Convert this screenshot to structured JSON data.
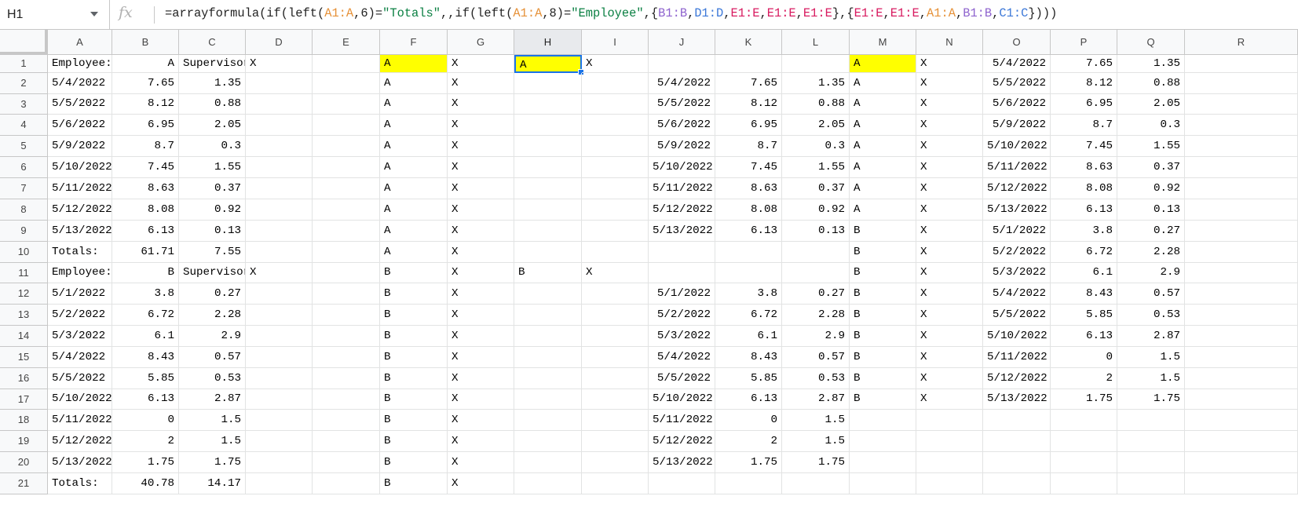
{
  "name_box": "H1",
  "fx_label": "fx",
  "formula": {
    "parts": [
      {
        "t": "=arrayformula(if(left(",
        "c": "#222222"
      },
      {
        "t": "A1:A",
        "c": "#e69138"
      },
      {
        "t": ",6)=",
        "c": "#222222"
      },
      {
        "t": "\"Totals\"",
        "c": "#0b8043"
      },
      {
        "t": ",,if(left(",
        "c": "#222222"
      },
      {
        "t": "A1:A",
        "c": "#e69138"
      },
      {
        "t": ",8)=",
        "c": "#222222"
      },
      {
        "t": "\"Employee\"",
        "c": "#0b8043"
      },
      {
        "t": ",{",
        "c": "#222222"
      },
      {
        "t": "B1:B",
        "c": "#8e63ce"
      },
      {
        "t": ",",
        "c": "#222222"
      },
      {
        "t": "D1:D",
        "c": "#3c78d8"
      },
      {
        "t": ",",
        "c": "#222222"
      },
      {
        "t": "E1:E",
        "c": "#d81b60"
      },
      {
        "t": ",",
        "c": "#222222"
      },
      {
        "t": "E1:E",
        "c": "#d81b60"
      },
      {
        "t": ",",
        "c": "#222222"
      },
      {
        "t": "E1:E",
        "c": "#d81b60"
      },
      {
        "t": "},{",
        "c": "#222222"
      },
      {
        "t": "E1:E",
        "c": "#d81b60"
      },
      {
        "t": ",",
        "c": "#222222"
      },
      {
        "t": "E1:E",
        "c": "#d81b60"
      },
      {
        "t": ",",
        "c": "#222222"
      },
      {
        "t": "A1:A",
        "c": "#e69138"
      },
      {
        "t": ",",
        "c": "#222222"
      },
      {
        "t": "B1:B",
        "c": "#8e63ce"
      },
      {
        "t": ",",
        "c": "#222222"
      },
      {
        "t": "C1:C",
        "c": "#3c78d8"
      },
      {
        "t": "})))",
        "c": "#222222"
      }
    ]
  },
  "columns": [
    "A",
    "B",
    "C",
    "D",
    "E",
    "F",
    "G",
    "H",
    "I",
    "J",
    "K",
    "L",
    "M",
    "N",
    "O",
    "P",
    "Q",
    "R"
  ],
  "selected_column": "H",
  "active_cell": "H1",
  "highlight_color": "#ffff00",
  "rows": [
    {
      "n": "1",
      "cells": {
        "A": "Employee:",
        "B": "A",
        "C": "Supervisor:",
        "D": "X",
        "F": "A",
        "G": "X",
        "H": "A",
        "I": "X",
        "M": "A",
        "N": "X",
        "O": "5/4/2022",
        "P": "7.65",
        "Q": "1.35"
      },
      "yellow": [
        "F",
        "H",
        "M"
      ]
    },
    {
      "n": "2",
      "cells": {
        "A": "5/4/2022",
        "B": "7.65",
        "C": "1.35",
        "F": "A",
        "G": "X",
        "J": "5/4/2022",
        "K": "7.65",
        "L": "1.35",
        "M": "A",
        "N": "X",
        "O": "5/5/2022",
        "P": "8.12",
        "Q": "0.88"
      }
    },
    {
      "n": "3",
      "cells": {
        "A": "5/5/2022",
        "B": "8.12",
        "C": "0.88",
        "F": "A",
        "G": "X",
        "J": "5/5/2022",
        "K": "8.12",
        "L": "0.88",
        "M": "A",
        "N": "X",
        "O": "5/6/2022",
        "P": "6.95",
        "Q": "2.05"
      }
    },
    {
      "n": "4",
      "cells": {
        "A": "5/6/2022",
        "B": "6.95",
        "C": "2.05",
        "F": "A",
        "G": "X",
        "J": "5/6/2022",
        "K": "6.95",
        "L": "2.05",
        "M": "A",
        "N": "X",
        "O": "5/9/2022",
        "P": "8.7",
        "Q": "0.3"
      }
    },
    {
      "n": "5",
      "cells": {
        "A": "5/9/2022",
        "B": "8.7",
        "C": "0.3",
        "F": "A",
        "G": "X",
        "J": "5/9/2022",
        "K": "8.7",
        "L": "0.3",
        "M": "A",
        "N": "X",
        "O": "5/10/2022",
        "P": "7.45",
        "Q": "1.55"
      }
    },
    {
      "n": "6",
      "cells": {
        "A": "5/10/2022",
        "B": "7.45",
        "C": "1.55",
        "F": "A",
        "G": "X",
        "J": "5/10/2022",
        "K": "7.45",
        "L": "1.55",
        "M": "A",
        "N": "X",
        "O": "5/11/2022",
        "P": "8.63",
        "Q": "0.37"
      }
    },
    {
      "n": "7",
      "cells": {
        "A": "5/11/2022",
        "B": "8.63",
        "C": "0.37",
        "F": "A",
        "G": "X",
        "J": "5/11/2022",
        "K": "8.63",
        "L": "0.37",
        "M": "A",
        "N": "X",
        "O": "5/12/2022",
        "P": "8.08",
        "Q": "0.92"
      }
    },
    {
      "n": "8",
      "cells": {
        "A": "5/12/2022",
        "B": "8.08",
        "C": "0.92",
        "F": "A",
        "G": "X",
        "J": "5/12/2022",
        "K": "8.08",
        "L": "0.92",
        "M": "A",
        "N": "X",
        "O": "5/13/2022",
        "P": "6.13",
        "Q": "0.13"
      }
    },
    {
      "n": "9",
      "cells": {
        "A": "5/13/2022",
        "B": "6.13",
        "C": "0.13",
        "F": "A",
        "G": "X",
        "J": "5/13/2022",
        "K": "6.13",
        "L": "0.13",
        "M": "B",
        "N": "X",
        "O": "5/1/2022",
        "P": "3.8",
        "Q": "0.27"
      }
    },
    {
      "n": "10",
      "cells": {
        "A": "Totals:",
        "B": "61.71",
        "C": "7.55",
        "F": "A",
        "G": "X",
        "M": "B",
        "N": "X",
        "O": "5/2/2022",
        "P": "6.72",
        "Q": "2.28"
      }
    },
    {
      "n": "11",
      "cells": {
        "A": "Employee:",
        "B": "B",
        "C": "Supervisor:",
        "D": "X",
        "F": "B",
        "G": "X",
        "H": "B",
        "I": "X",
        "M": "B",
        "N": "X",
        "O": "5/3/2022",
        "P": "6.1",
        "Q": "2.9"
      }
    },
    {
      "n": "12",
      "cells": {
        "A": "5/1/2022",
        "B": "3.8",
        "C": "0.27",
        "F": "B",
        "G": "X",
        "J": "5/1/2022",
        "K": "3.8",
        "L": "0.27",
        "M": "B",
        "N": "X",
        "O": "5/4/2022",
        "P": "8.43",
        "Q": "0.57"
      }
    },
    {
      "n": "13",
      "cells": {
        "A": "5/2/2022",
        "B": "6.72",
        "C": "2.28",
        "F": "B",
        "G": "X",
        "J": "5/2/2022",
        "K": "6.72",
        "L": "2.28",
        "M": "B",
        "N": "X",
        "O": "5/5/2022",
        "P": "5.85",
        "Q": "0.53"
      }
    },
    {
      "n": "14",
      "cells": {
        "A": "5/3/2022",
        "B": "6.1",
        "C": "2.9",
        "F": "B",
        "G": "X",
        "J": "5/3/2022",
        "K": "6.1",
        "L": "2.9",
        "M": "B",
        "N": "X",
        "O": "5/10/2022",
        "P": "6.13",
        "Q": "2.87"
      }
    },
    {
      "n": "15",
      "cells": {
        "A": "5/4/2022",
        "B": "8.43",
        "C": "0.57",
        "F": "B",
        "G": "X",
        "J": "5/4/2022",
        "K": "8.43",
        "L": "0.57",
        "M": "B",
        "N": "X",
        "O": "5/11/2022",
        "P": "0",
        "Q": "1.5"
      }
    },
    {
      "n": "16",
      "cells": {
        "A": "5/5/2022",
        "B": "5.85",
        "C": "0.53",
        "F": "B",
        "G": "X",
        "J": "5/5/2022",
        "K": "5.85",
        "L": "0.53",
        "M": "B",
        "N": "X",
        "O": "5/12/2022",
        "P": "2",
        "Q": "1.5"
      }
    },
    {
      "n": "17",
      "cells": {
        "A": "5/10/2022",
        "B": "6.13",
        "C": "2.87",
        "F": "B",
        "G": "X",
        "J": "5/10/2022",
        "K": "6.13",
        "L": "2.87",
        "M": "B",
        "N": "X",
        "O": "5/13/2022",
        "P": "1.75",
        "Q": "1.75"
      }
    },
    {
      "n": "18",
      "cells": {
        "A": "5/11/2022",
        "B": "0",
        "C": "1.5",
        "F": "B",
        "G": "X",
        "J": "5/11/2022",
        "K": "0",
        "L": "1.5"
      }
    },
    {
      "n": "19",
      "cells": {
        "A": "5/12/2022",
        "B": "2",
        "C": "1.5",
        "F": "B",
        "G": "X",
        "J": "5/12/2022",
        "K": "2",
        "L": "1.5"
      }
    },
    {
      "n": "20",
      "cells": {
        "A": "5/13/2022",
        "B": "1.75",
        "C": "1.75",
        "F": "B",
        "G": "X",
        "J": "5/13/2022",
        "K": "1.75",
        "L": "1.75"
      }
    },
    {
      "n": "21",
      "cells": {
        "A": "Totals:",
        "B": "40.78",
        "C": "14.17",
        "F": "B",
        "G": "X"
      }
    }
  ]
}
